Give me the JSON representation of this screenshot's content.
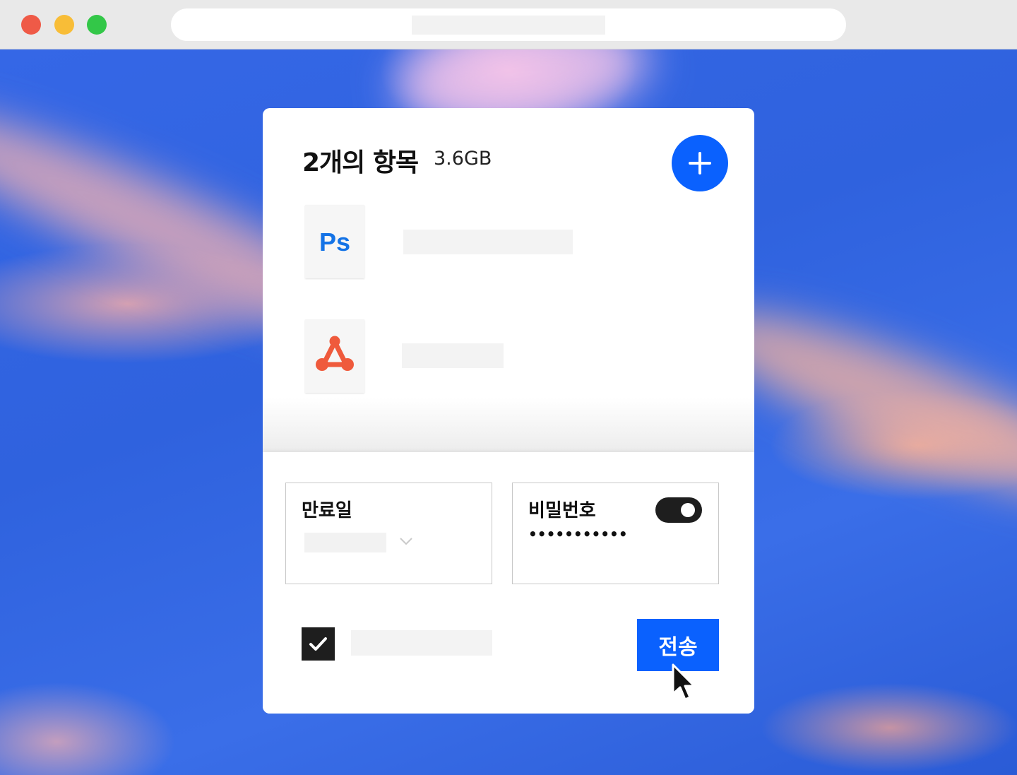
{
  "panel": {
    "title": "2개의 항목",
    "total_size": "3.6GB"
  },
  "files": [
    {
      "icon": "photoshop-icon",
      "icon_text": "Ps"
    },
    {
      "icon": "acrobat-pdf-icon"
    }
  ],
  "options": {
    "expiry_label": "만료일",
    "password_label": "비밀번호",
    "password_value": "•••••••••••",
    "password_enabled": true
  },
  "footer": {
    "checkbox_checked": true,
    "send_label": "전송"
  },
  "colors": {
    "accent": "#0a61fe",
    "photoshop": "#1473e6",
    "acrobat": "#ef5a3c"
  }
}
